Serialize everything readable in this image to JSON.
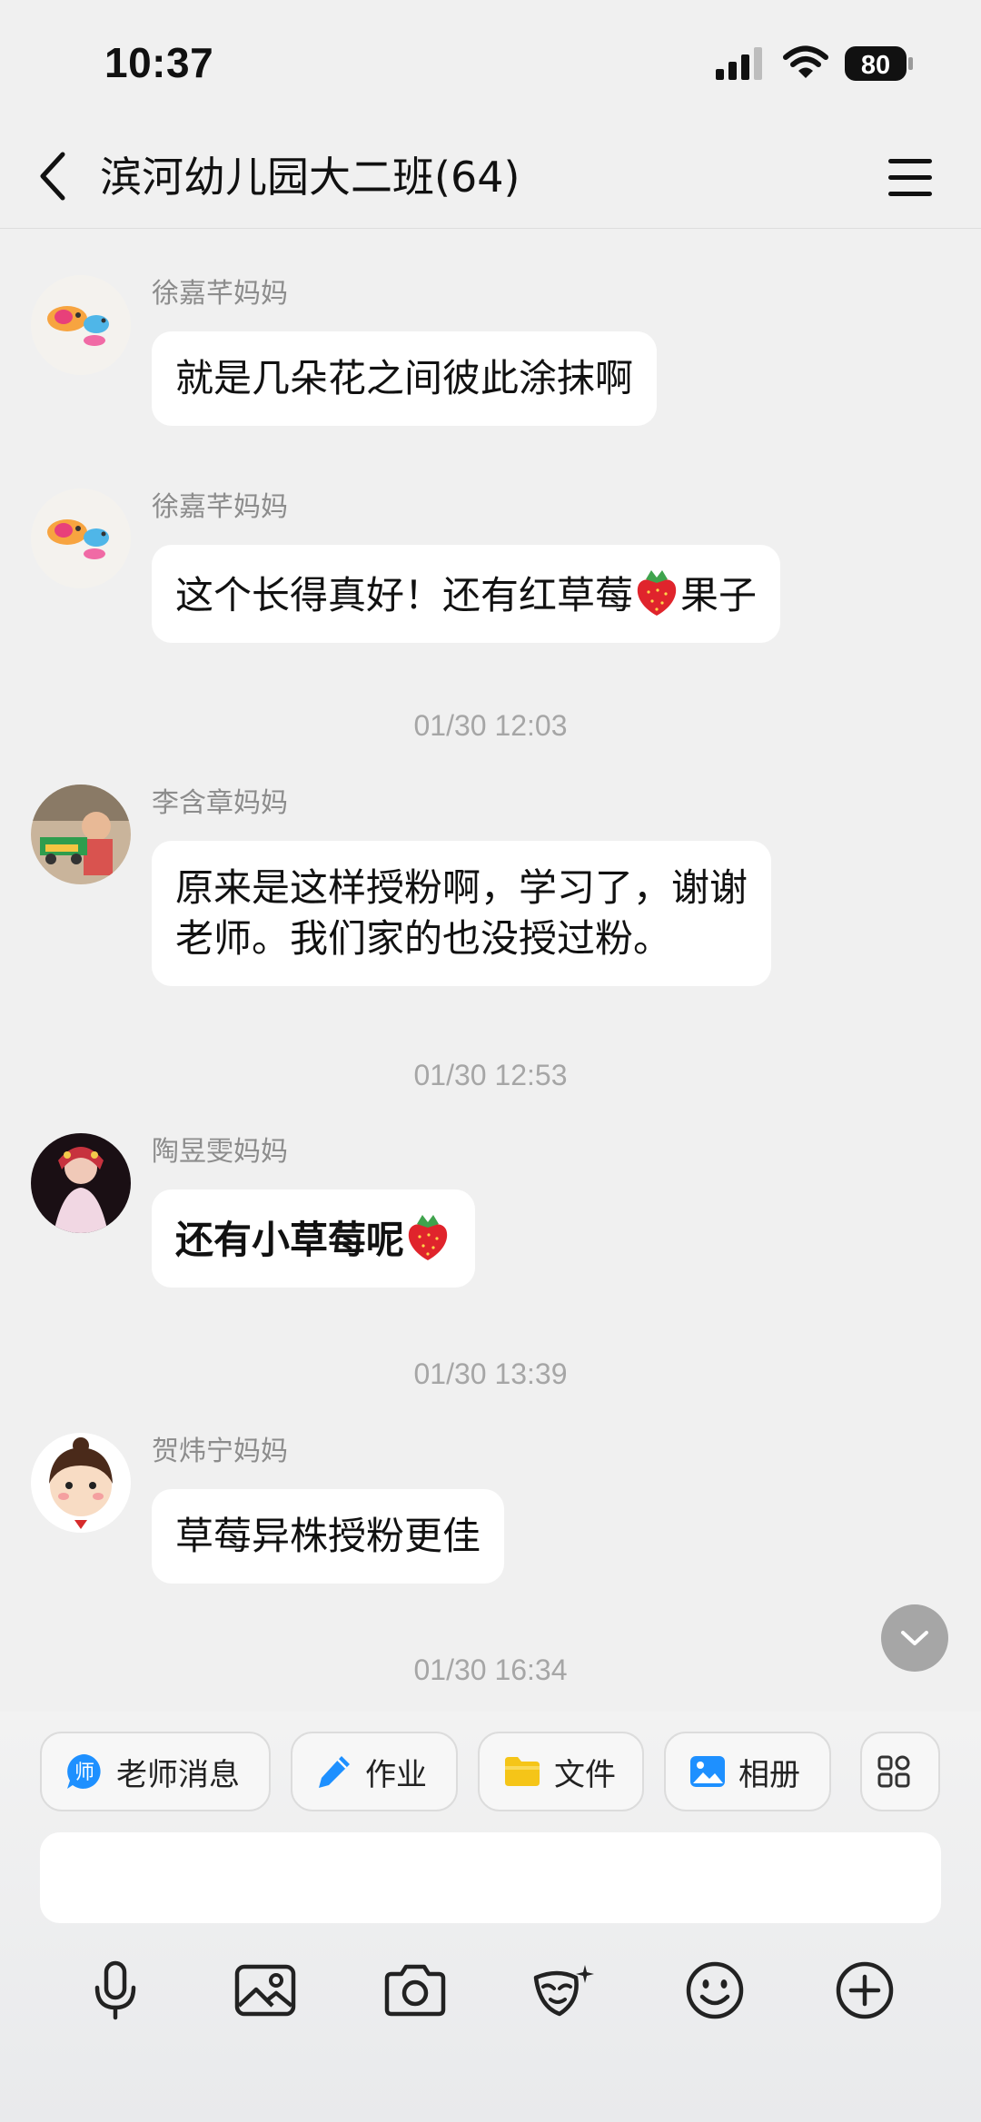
{
  "status_bar": {
    "time": "10:37",
    "battery": "80"
  },
  "header": {
    "title": "滨河幼儿园大二班(64)"
  },
  "messages": [
    {
      "sender": "徐嘉芊妈妈",
      "text": "就是几朵花之间彼此涂抹啊"
    },
    {
      "sender": "徐嘉芊妈妈",
      "text_before": "这个长得真好！还有红草莓",
      "text_after": "果子"
    },
    {
      "sender": "李含章妈妈",
      "line1": "原来是这样授粉啊，学习了，谢谢",
      "line2": "老师。我们家的也没授过粉。"
    },
    {
      "sender": "陶昱雯妈妈",
      "text": "还有小草莓呢"
    },
    {
      "sender": "贺炜宁妈妈",
      "text": "草莓异株授粉更佳"
    }
  ],
  "timestamps": [
    "01/30 12:03",
    "01/30 12:53",
    "01/30 13:39",
    "01/30 16:34"
  ],
  "quick_actions": [
    {
      "label": "老师消息",
      "icon": "teacher-message-icon",
      "icon_char": "师"
    },
    {
      "label": "作业",
      "icon": "pencil-icon"
    },
    {
      "label": "文件",
      "icon": "folder-icon"
    },
    {
      "label": "相册",
      "icon": "photo-album-icon"
    }
  ],
  "toolbar_icons": [
    "microphone-icon",
    "image-icon",
    "camera-icon",
    "mask-icon",
    "emoji-icon",
    "plus-icon"
  ],
  "colors": {
    "background": "#f0f0f0",
    "bubble": "#ffffff",
    "accent_blue": "#1e90ff",
    "folder_yellow": "#f5c518"
  }
}
